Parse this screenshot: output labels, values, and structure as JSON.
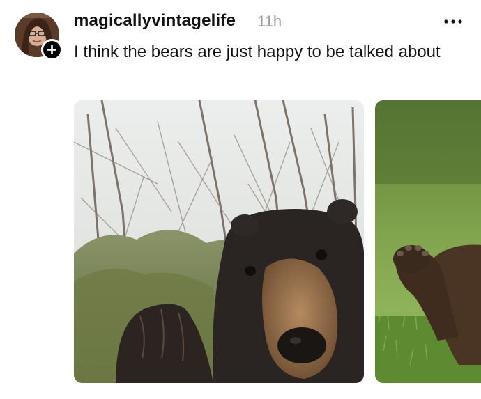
{
  "post": {
    "username": "magicallyvintagelife",
    "timestamp": "11h",
    "caption": "I think the bears are just happy to be talked about",
    "more_icon": "ellipsis-icon",
    "follow_icon": "plus-icon"
  },
  "colors": {
    "text": "#111111",
    "muted": "#9a9a9a",
    "background": "#ffffff"
  }
}
